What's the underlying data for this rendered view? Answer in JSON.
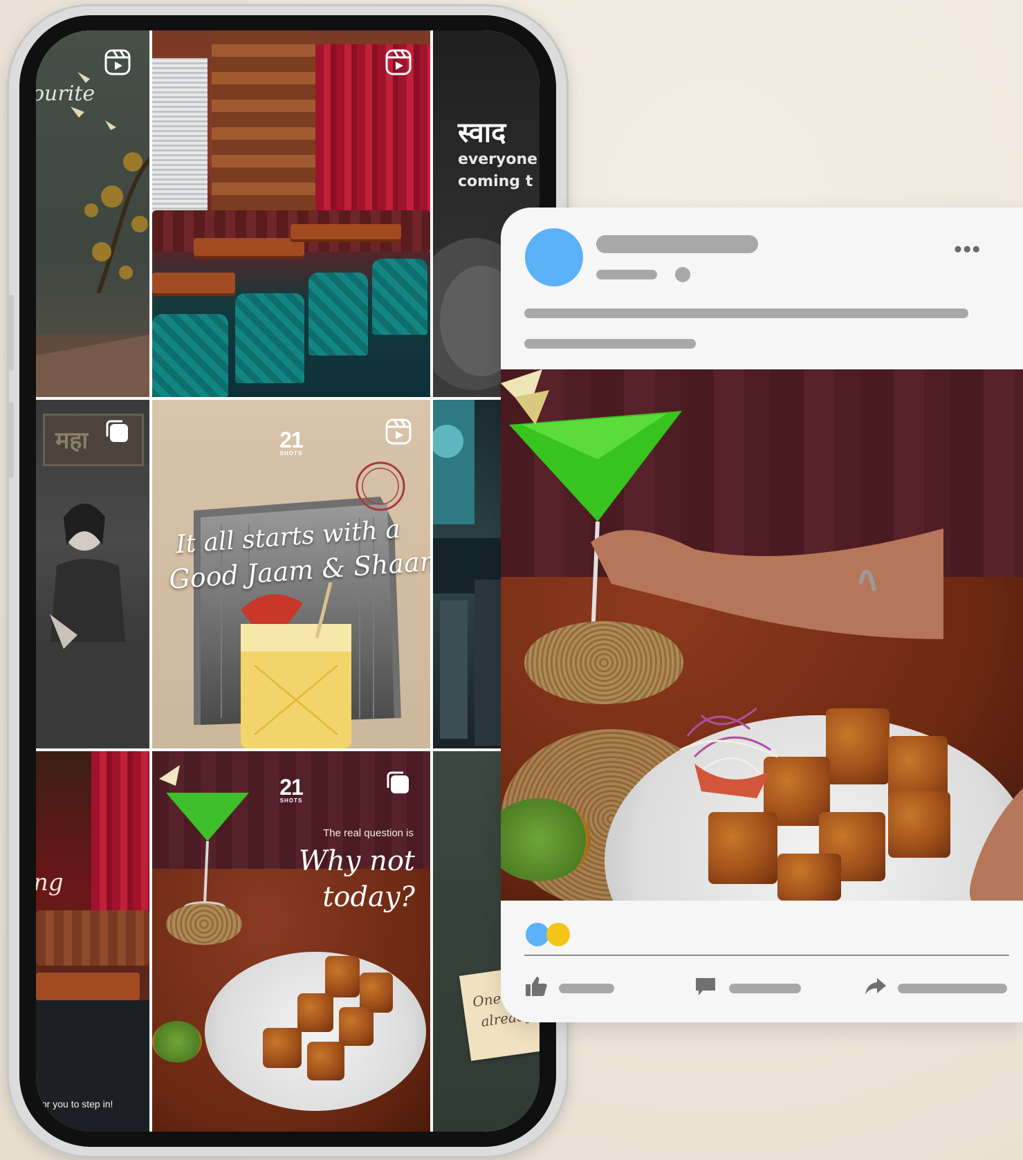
{
  "phone_grid": {
    "tile_1": {
      "text": "ourite",
      "icon": "reel-icon"
    },
    "tile_2": {
      "icon": "reel-icon"
    },
    "tile_3": {
      "hindi_title": "स्वाद",
      "line1": "everyone",
      "line2": "coming t"
    },
    "tile_4": {
      "sign": "महा",
      "icon": "carousel-icon"
    },
    "tile_5": {
      "logo": "21",
      "logo_sub": "SHOTS",
      "headline_line1": "It all starts with a",
      "headline_line2": "Good Jaam & Shaam",
      "icon": "reel-icon"
    },
    "tile_7": {
      "text_side": "ng",
      "caption": "for you to step in!"
    },
    "tile_8": {
      "logo": "21",
      "logo_sub": "SHOTS",
      "question": "The real question is",
      "script1": "Why not",
      "script2": "today?",
      "icon": "carousel-icon"
    },
    "tile_9": {
      "note1": "One sip,",
      "note2": "already"
    }
  },
  "post": {
    "more_label": "•••",
    "avatar_color": "#5bb1f7",
    "reactions": [
      "#5bb1f7",
      "#f5c518"
    ],
    "actions": [
      {
        "icon": "like-icon"
      },
      {
        "icon": "comment-icon"
      },
      {
        "icon": "share-icon"
      }
    ]
  }
}
